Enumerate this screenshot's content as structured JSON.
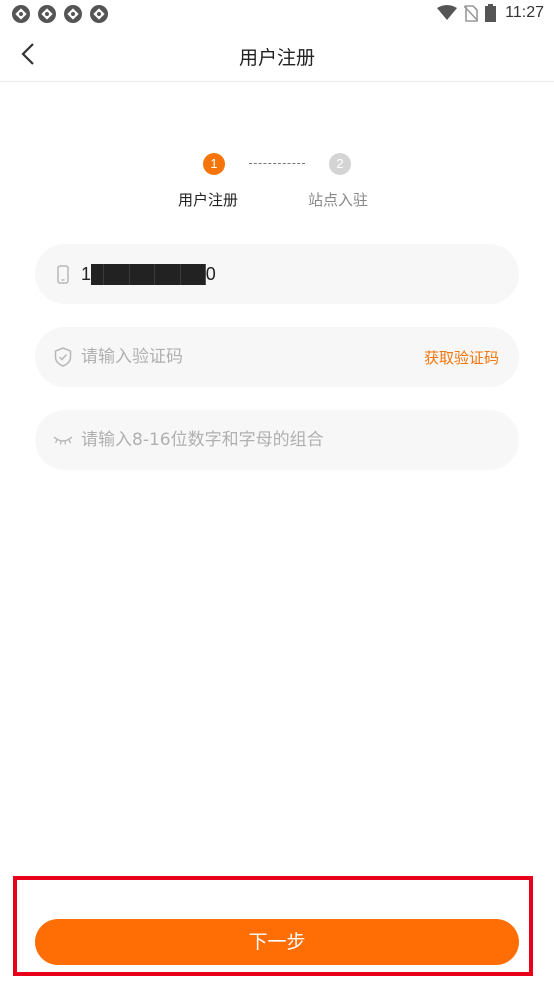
{
  "status_bar": {
    "time": "11:27",
    "notification_icons": [
      "app-notification-icon",
      "app-notification-icon",
      "app-notification-icon",
      "app-notification-icon"
    ],
    "system_icons": [
      "wifi-icon",
      "no-sim-icon",
      "battery-icon"
    ]
  },
  "header": {
    "title": "用户注册",
    "back_icon": "chevron-left-icon"
  },
  "stepper": {
    "steps": [
      {
        "number": "1",
        "label": "用户注册",
        "active": true
      },
      {
        "number": "2",
        "label": "站点入驻",
        "active": false
      }
    ]
  },
  "form": {
    "phone": {
      "value": "1█████████0",
      "icon": "phone-icon"
    },
    "code": {
      "placeholder": "请输入验证码",
      "value": "",
      "icon": "shield-icon",
      "action_label": "获取验证码"
    },
    "password": {
      "placeholder": "请输入8-16位数字和字母的组合",
      "value": "",
      "icon": "eye-closed-icon"
    }
  },
  "footer": {
    "next_label": "下一步"
  },
  "colors": {
    "accent": "#ff6e05",
    "highlight": "#e8001a",
    "field_bg": "#f7f7f7"
  }
}
